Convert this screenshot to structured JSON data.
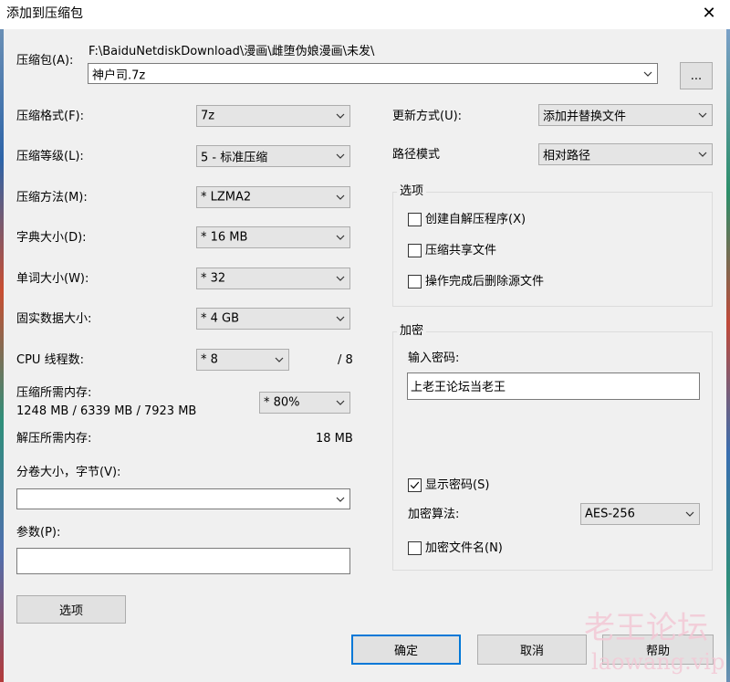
{
  "window": {
    "title": "添加到压缩包",
    "close_glyph": "✕"
  },
  "archive": {
    "label": "压缩包(A):",
    "path": "F:\\BaiduNetdiskDownload\\漫画\\雌堕伪娘漫画\\未发\\",
    "filename": "神户司.7z",
    "browse_label": "..."
  },
  "settings": {
    "format": {
      "label": "压缩格式(F):",
      "value": "7z"
    },
    "level": {
      "label": "压缩等级(L):",
      "value": "5 - 标准压缩"
    },
    "method": {
      "label": "压缩方法(M):",
      "value": "*  LZMA2"
    },
    "dict": {
      "label": "字典大小(D):",
      "value": "*  16 MB"
    },
    "word": {
      "label": "单词大小(W):",
      "value": "*  32"
    },
    "solid": {
      "label": "固实数据大小:",
      "value": "*  4 GB"
    },
    "threads": {
      "label": "CPU 线程数:",
      "value": "*  8",
      "max": "/ 8"
    },
    "mem_compress": {
      "label": "压缩所需内存:",
      "detail": "1248 MB / 6339 MB / 7923 MB",
      "value": "*  80%"
    },
    "mem_decompress": {
      "label": "解压所需内存:",
      "value": "18 MB"
    },
    "volume": {
      "label": "分卷大小，字节(V):",
      "value": ""
    },
    "params": {
      "label": "参数(P):",
      "value": ""
    },
    "options_button": "选项"
  },
  "update": {
    "label": "更新方式(U):",
    "value": "添加并替换文件"
  },
  "path_mode": {
    "label": "路径模式",
    "value": "相对路径"
  },
  "options_group": {
    "title": "选项",
    "items": [
      {
        "label": "创建自解压程序(X)",
        "checked": false
      },
      {
        "label": "压缩共享文件",
        "checked": false
      },
      {
        "label": "操作完成后删除源文件",
        "checked": false
      }
    ]
  },
  "encryption": {
    "title": "加密",
    "password_label": "输入密码:",
    "password_value": "上老王论坛当老王",
    "show_password": {
      "label": "显示密码(S)",
      "checked": true
    },
    "method_label": "加密算法:",
    "method_value": "AES-256",
    "encrypt_names": {
      "label": "加密文件名(N)",
      "checked": false
    }
  },
  "buttons": {
    "ok": "确定",
    "cancel": "取消",
    "help": "帮助"
  },
  "watermark": {
    "line1": "老王论坛",
    "line2": "laowang.vip"
  },
  "colors": {
    "accent": "#0078d7",
    "background": "#f0f0f0"
  }
}
